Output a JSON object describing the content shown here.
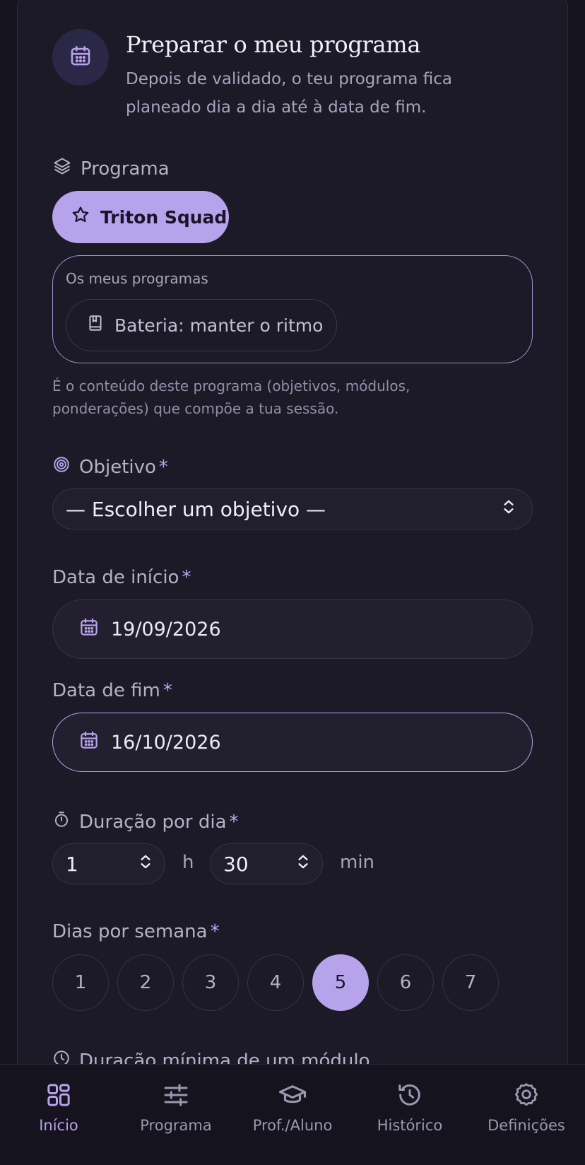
{
  "header": {
    "title": "Preparar o meu programa",
    "subtitle": "Depois de validado, o teu programa fica planeado dia a dia até à data de fim.",
    "icon": "calendar-icon"
  },
  "programa": {
    "label": "Programa",
    "selected": "Triton Squad",
    "mine_label": "Os meus programas",
    "mine_items": [
      "Bateria: manter o ritmo"
    ],
    "help": "É o conteúdo deste programa (objetivos, módulos, ponderações) que compõe a tua sessão."
  },
  "objetivo": {
    "label": "Objetivo",
    "required": "*",
    "value": "— Escolher um objetivo —"
  },
  "data_inicio": {
    "label": "Data de início",
    "required": "*",
    "value": "19/09/2026"
  },
  "data_fim": {
    "label": "Data de fim",
    "required": "*",
    "value": "16/10/2026"
  },
  "duracao": {
    "label": "Duração por dia",
    "required": "*",
    "hours": "1",
    "hours_unit": "h",
    "minutes": "30",
    "minutes_unit": "min"
  },
  "dias": {
    "label": "Dias por semana",
    "required": "*",
    "options": [
      "1",
      "2",
      "3",
      "4",
      "5",
      "6",
      "7"
    ],
    "selected": "5"
  },
  "duracao_minima": {
    "label": "Duração mínima de um módulo"
  },
  "nav": {
    "items": [
      {
        "label": "Início",
        "icon": "grid-icon",
        "active": true
      },
      {
        "label": "Programa",
        "icon": "sliders-icon",
        "active": false
      },
      {
        "label": "Prof./Aluno",
        "icon": "graduation-cap-icon",
        "active": false
      },
      {
        "label": "Histórico",
        "icon": "history-icon",
        "active": false
      },
      {
        "label": "Definições",
        "icon": "gear-icon",
        "active": false
      }
    ]
  },
  "colors": {
    "accent": "#b7a2ec",
    "background": "#15131d",
    "card": "#1c1a27"
  }
}
